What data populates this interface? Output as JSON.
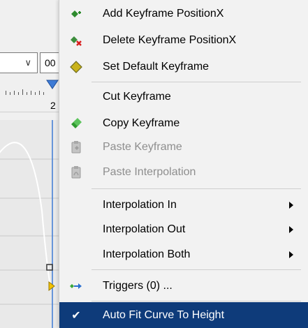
{
  "background": {
    "combo_a_chevron": "∨",
    "combo_b_value": "00",
    "ruler_label": "2"
  },
  "menu": {
    "items": [
      {
        "label": "Add Keyframe PositionX",
        "icon": "add-keyframe-icon",
        "enabled": true
      },
      {
        "label": "Delete Keyframe PositionX",
        "icon": "delete-keyframe-icon",
        "enabled": true
      },
      {
        "label": "Set Default Keyframe",
        "icon": "default-keyframe-icon",
        "enabled": true
      },
      {
        "label": "Cut Keyframe",
        "icon": "",
        "enabled": true
      },
      {
        "label": "Copy Keyframe",
        "icon": "copy-keyframe-icon",
        "enabled": true
      },
      {
        "label": "Paste Keyframe",
        "icon": "paste-keyframe-icon",
        "enabled": false
      },
      {
        "label": "Paste Interpolation",
        "icon": "paste-interpolation-icon",
        "enabled": false
      },
      {
        "label": "Interpolation In",
        "submenu": true,
        "enabled": true
      },
      {
        "label": "Interpolation Out",
        "submenu": true,
        "enabled": true
      },
      {
        "label": "Interpolation Both",
        "submenu": true,
        "enabled": true
      },
      {
        "label": "Triggers (0) ...",
        "icon": "triggers-icon",
        "enabled": true
      },
      {
        "label": "Auto Fit Curve To Height",
        "icon": "checkmark-icon",
        "checked": true,
        "enabled": true
      }
    ],
    "check_glyph": "✔"
  },
  "colors": {
    "menu_bg": "#f2f2f2",
    "highlight_bg": "#0e3b7a",
    "disabled_text": "#8e8e8e",
    "curve_line": "#ffffff",
    "playhead": "#3d7bd6"
  }
}
